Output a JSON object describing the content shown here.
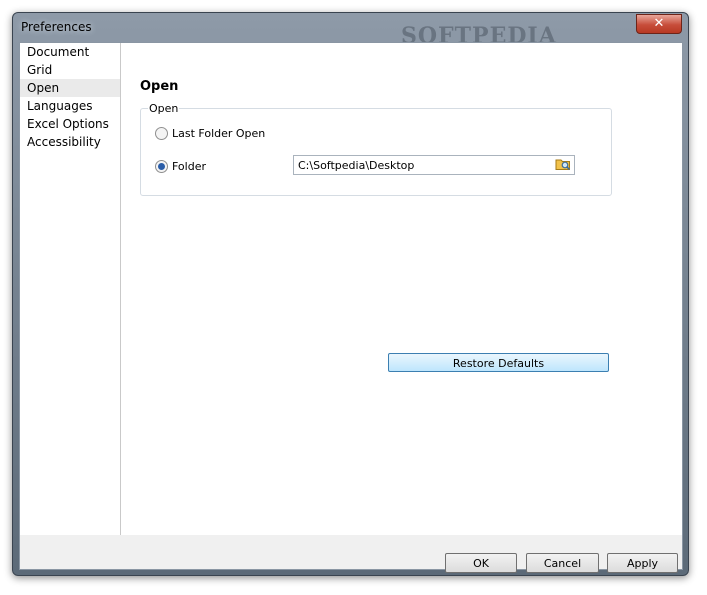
{
  "window": {
    "title": "Preferences",
    "close_glyph": "✕"
  },
  "sidebar": {
    "items": [
      {
        "label": "Document"
      },
      {
        "label": "Grid"
      },
      {
        "label": "Open",
        "selected": true
      },
      {
        "label": "Languages"
      },
      {
        "label": "Excel Options"
      },
      {
        "label": "Accessibility"
      }
    ]
  },
  "panel": {
    "heading": "Open",
    "group_label": "Open",
    "radio_last_folder": "Last Folder Open",
    "radio_folder": "Folder",
    "selected_option": "Folder",
    "folder_path": "C:\\Softpedia\\Desktop",
    "browse_icon": "folder-browse-icon",
    "restore_label": "Restore Defaults"
  },
  "footer": {
    "ok_label": "OK",
    "cancel_label": "Cancel",
    "apply_label": "Apply"
  },
  "watermark": "SOFTPEDIA",
  "colors": {
    "accent": "#2a5da8",
    "close_button": "#c74d3a"
  }
}
